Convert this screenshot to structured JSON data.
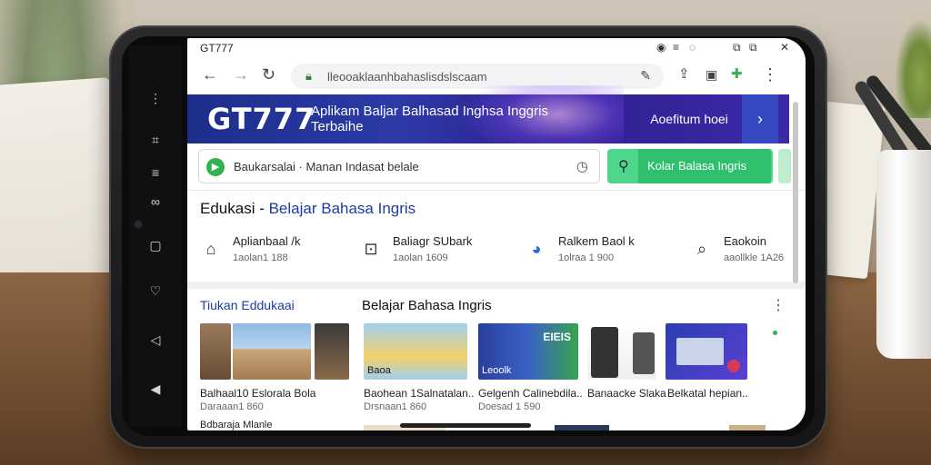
{
  "browser": {
    "tab_title": "GT777",
    "url": "lleooaklaanhbahaslisdslscaam",
    "window_icons": [
      "record-icon",
      "hamburger-icon",
      "minimize-icon",
      "tabs-icon",
      "close-icon"
    ]
  },
  "banner": {
    "logo": "GT777",
    "tagline": "Aplikam Baljar Balhasad Inghsa Inggris Terbaihe",
    "cta_label": "Aoefitum hoei",
    "cta_arrow": "›"
  },
  "search": {
    "placeholder": "Baukarsalai · Manan Indasat belale",
    "button_label": "Kolar Balasa Ingris"
  },
  "section": {
    "title_prefix": "Edukasi",
    "title_dash": " - ",
    "title_accent": "Belajar Bahasa Ingris"
  },
  "stats": [
    {
      "icon": "home-icon",
      "name": "Aplianbaal /k",
      "meta": "1aolan1 188"
    },
    {
      "icon": "chat-icon",
      "name": "Baliagr SUbark",
      "meta": "1aolan 1609"
    },
    {
      "icon": "badge-icon",
      "name": "Ralkem Baol k",
      "meta": "1olraa 1 900"
    },
    {
      "icon": "search-icon",
      "name": "Eaokoin",
      "meta": "aaollkle 1A26"
    }
  ],
  "columns": {
    "left_title": "Tiukan Eddukaai",
    "right_title": "Belajar Bahasa Ingris"
  },
  "cards": [
    {
      "title": "Balhaal10 Eslorala Bola",
      "meta": "Daraaan1 860"
    },
    {
      "title": "Baohean 1Salnatalan..",
      "meta": "Drsnaan1 860"
    },
    {
      "title": "Gelgenh Calinebdila..",
      "meta": "Doesad 1 590"
    },
    {
      "title": "Banaacke Slaka",
      "meta": ""
    },
    {
      "title": "Belkatal hepian..",
      "meta": ""
    }
  ],
  "thumb_texts": {
    "map_label": "Baoa",
    "book_label": "Leoolk",
    "poster_label": "EIEIS"
  },
  "bottom_row_text": "Bdbaraja Mlanle",
  "colors": {
    "accent": "#1f3aa6",
    "banner": "#2d3aa8",
    "green": "#2fc06e"
  }
}
